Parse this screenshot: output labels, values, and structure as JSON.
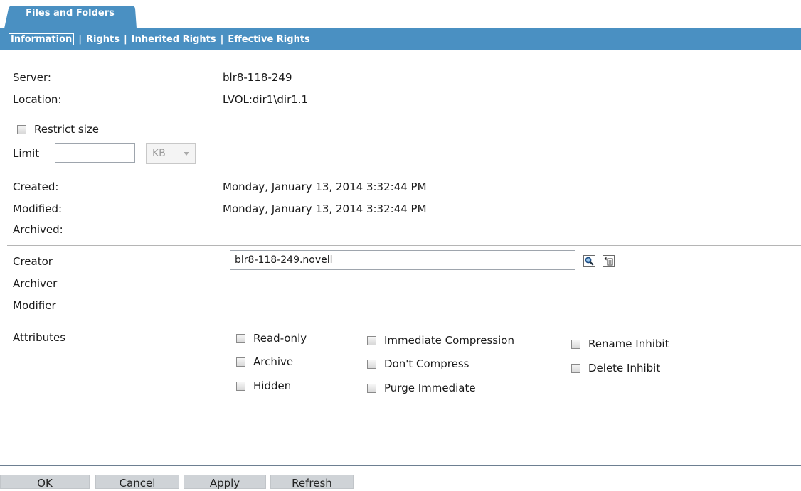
{
  "tabs": {
    "active": "Files and Folders"
  },
  "subnav": {
    "items": [
      "Information",
      "Rights",
      "Inherited Rights",
      "Effective Rights"
    ],
    "separator": "|"
  },
  "info": {
    "server_label": "Server:",
    "server_value": "blr8-118-249",
    "location_label": "Location:",
    "location_value": "LVOL:dir1\\dir1.1"
  },
  "size": {
    "restrict_label": "Restrict size",
    "restrict_checked": false,
    "limit_label": "Limit",
    "limit_value": "",
    "unit_selected": "KB"
  },
  "dates": {
    "created_label": "Created:",
    "created_value": "Monday, January 13, 2014 3:32:44 PM",
    "modified_label": "Modified:",
    "modified_value": "Monday, January 13, 2014 3:32:44 PM",
    "archived_label": "Archived:",
    "archived_value": ""
  },
  "owners": {
    "creator_label": "Creator",
    "creator_value": "blr8-118-249.novell",
    "archiver_label": "Archiver",
    "modifier_label": "Modifier",
    "browse_icon": "magnifier-icon",
    "history_icon": "object-history-icon"
  },
  "attributes": {
    "label": "Attributes",
    "col1": [
      "Read-only",
      "Archive",
      "Hidden"
    ],
    "col2": [
      "Immediate Compression",
      "Don't Compress",
      "Purge Immediate"
    ],
    "col3": [
      "Rename Inhibit",
      "Delete Inhibit"
    ]
  },
  "buttons": {
    "ok": "OK",
    "cancel": "Cancel",
    "apply": "Apply",
    "refresh": "Refresh"
  },
  "colors": {
    "accent": "#4a90c2",
    "button": "#cfd3d7",
    "divider": "#b5b5b5"
  }
}
